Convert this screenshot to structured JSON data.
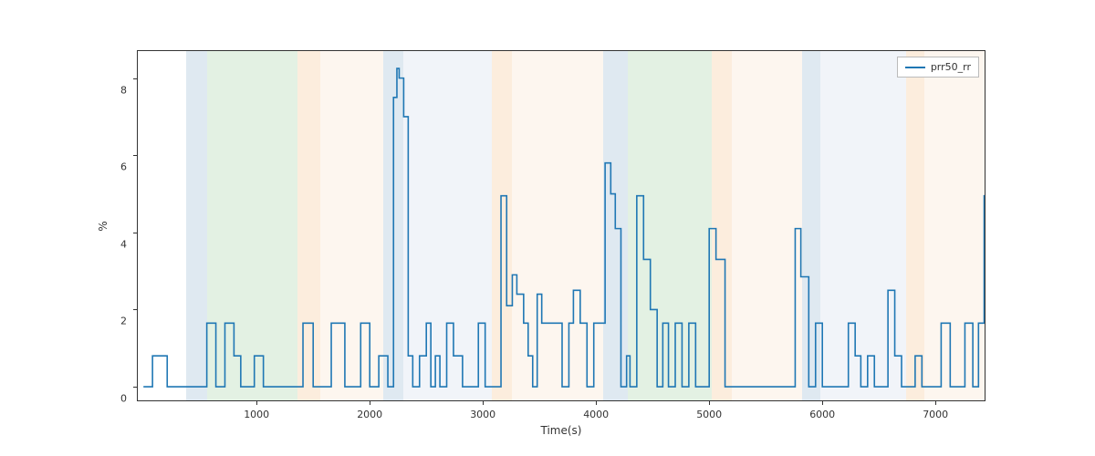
{
  "chart_data": {
    "type": "line",
    "title": "",
    "xlabel": "Time(s)",
    "ylabel": "%",
    "xlim": [
      -50,
      7450
    ],
    "ylim": [
      -0.4,
      8.7
    ],
    "xticks": [
      1000,
      2000,
      3000,
      4000,
      5000,
      6000,
      7000
    ],
    "yticks": [
      0,
      2,
      4,
      6,
      8
    ],
    "legend": [
      "prr50_rr"
    ],
    "legend_position": "upper right",
    "bands": [
      {
        "start": 380,
        "end": 560,
        "color": "blue"
      },
      {
        "start": 560,
        "end": 1360,
        "color": "green"
      },
      {
        "start": 1360,
        "end": 1560,
        "color": "orange"
      },
      {
        "start": 1560,
        "end": 2120,
        "color": "lightorange"
      },
      {
        "start": 2120,
        "end": 2300,
        "color": "blue"
      },
      {
        "start": 2300,
        "end": 3080,
        "color": "lightblue"
      },
      {
        "start": 3080,
        "end": 3260,
        "color": "orange"
      },
      {
        "start": 3260,
        "end": 4060,
        "color": "lightorange"
      },
      {
        "start": 4060,
        "end": 4280,
        "color": "blue"
      },
      {
        "start": 4280,
        "end": 5020,
        "color": "green"
      },
      {
        "start": 5020,
        "end": 5200,
        "color": "orange"
      },
      {
        "start": 5200,
        "end": 5820,
        "color": "lightorange"
      },
      {
        "start": 5820,
        "end": 5980,
        "color": "blue"
      },
      {
        "start": 5980,
        "end": 6740,
        "color": "lightblue"
      },
      {
        "start": 6740,
        "end": 6900,
        "color": "orange"
      },
      {
        "start": 6900,
        "end": 7450,
        "color": "lightorange"
      }
    ],
    "series": [
      {
        "name": "prr50_rr",
        "color": "#1f77b4",
        "step": true,
        "x": [
          0,
          80,
          210,
          280,
          420,
          560,
          640,
          720,
          800,
          860,
          980,
          1060,
          1150,
          1230,
          1410,
          1500,
          1600,
          1660,
          1780,
          1860,
          1920,
          2000,
          2080,
          2160,
          2210,
          2240,
          2260,
          2300,
          2340,
          2380,
          2440,
          2500,
          2540,
          2580,
          2620,
          2680,
          2740,
          2820,
          2900,
          2960,
          3020,
          3060,
          3110,
          3160,
          3210,
          3260,
          3300,
          3360,
          3400,
          3440,
          3480,
          3520,
          3580,
          3640,
          3700,
          3760,
          3800,
          3860,
          3920,
          3980,
          4040,
          4080,
          4130,
          4170,
          4220,
          4270,
          4300,
          4360,
          4420,
          4480,
          4540,
          4590,
          4640,
          4700,
          4760,
          4820,
          4880,
          4940,
          5000,
          5060,
          5140,
          5200,
          5260,
          5700,
          5760,
          5810,
          5880,
          5940,
          6000,
          6060,
          6120,
          6180,
          6230,
          6290,
          6340,
          6400,
          6460,
          6520,
          6580,
          6640,
          6700,
          6760,
          6820,
          6880,
          6950,
          7050,
          7130,
          7200,
          7260,
          7330,
          7380,
          7430,
          7450
        ],
        "y": [
          0,
          0.8,
          0,
          0,
          0,
          1.65,
          0,
          1.65,
          0.8,
          0,
          0.8,
          0,
          0,
          0,
          1.65,
          0,
          0,
          1.65,
          0,
          0,
          1.65,
          0,
          0.8,
          0,
          7.5,
          8.25,
          8.0,
          7.0,
          0.8,
          0,
          0.8,
          1.65,
          0,
          0.8,
          0,
          1.65,
          0.8,
          0,
          0,
          1.65,
          0,
          0,
          0,
          4.95,
          2.1,
          2.9,
          2.4,
          1.65,
          0.8,
          0,
          2.4,
          1.65,
          1.65,
          1.65,
          0,
          1.65,
          2.5,
          1.65,
          0,
          1.65,
          1.65,
          5.8,
          5.0,
          4.1,
          0,
          0.8,
          0,
          4.95,
          3.3,
          2.0,
          0,
          1.65,
          0,
          1.65,
          0,
          1.65,
          0,
          0,
          4.1,
          3.3,
          0,
          0,
          0,
          0,
          4.1,
          2.85,
          0,
          1.65,
          0,
          0,
          0,
          0,
          1.65,
          0.8,
          0,
          0.8,
          0,
          0,
          2.5,
          0.8,
          0,
          0,
          0.8,
          0,
          0,
          1.65,
          0,
          0,
          1.65,
          0,
          1.65,
          4.95,
          4.95
        ]
      }
    ]
  }
}
